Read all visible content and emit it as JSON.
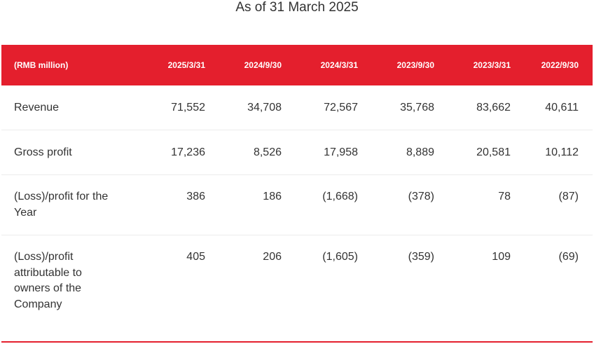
{
  "title": "As of 31 March 2025",
  "table": {
    "header": {
      "label": "(RMB million)",
      "columns": [
        "2025/3/31",
        "2024/9/30",
        "2024/3/31",
        "2023/9/30",
        "2023/3/31",
        "2022/9/30"
      ]
    },
    "rows": [
      {
        "label": "Revenue",
        "values": [
          "71,552",
          "34,708",
          "72,567",
          "35,768",
          "83,662",
          "40,611"
        ]
      },
      {
        "label": "Gross profit",
        "values": [
          "17,236",
          "8,526",
          "17,958",
          "8,889",
          "20,581",
          "10,112"
        ]
      },
      {
        "label": "(Loss)/profit for the Year",
        "values": [
          "386",
          "186",
          "(1,668)",
          "(378)",
          "78",
          "(87)"
        ]
      },
      {
        "label": "(Loss)/profit attributable to owners of the Company",
        "values": [
          "405",
          "206",
          "(1,605)",
          "(359)",
          "109",
          "(69)"
        ]
      }
    ]
  },
  "colors": {
    "header_background": "#e41f2d",
    "header_text": "#ffffff",
    "body_text": "#333333",
    "row_divider": "#ececec"
  }
}
